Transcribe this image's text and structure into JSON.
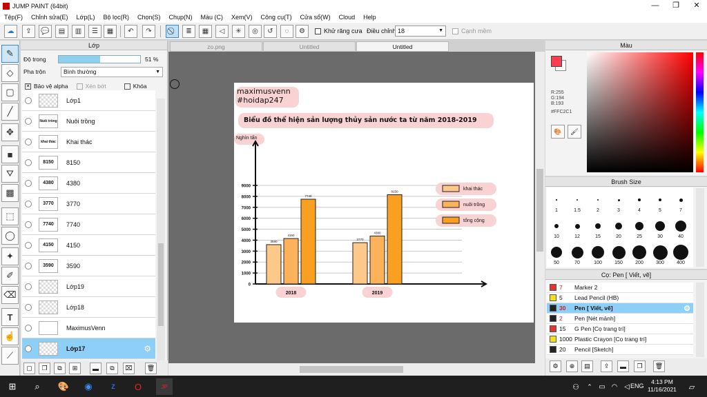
{
  "window": {
    "title": "JUMP PAINT (64bit)",
    "min": "—",
    "max": "❐",
    "close": "✕"
  },
  "menu": [
    "Tệp(F)",
    "Chỉnh sửa(E)",
    "Lớp(L)",
    "Bộ lọc(R)",
    "Chọn(S)",
    "Chụp(N)",
    "Màu (C)",
    "Xem(V)",
    "Công cụ(T)",
    "Cửa sổ(W)",
    "Cloud",
    "Help"
  ],
  "toolbar": {
    "antialias_label": "Khử răng cưa",
    "adjust_label": "Điều chỉnh",
    "adjust_value": "18",
    "smooth_label": "Cạnh mềm"
  },
  "layer_panel": {
    "title": "Lớp",
    "opacity_label": "Độ trong",
    "opacity_value": "51 %",
    "opacity_fraction": 0.51,
    "blend_label": "Pha trộn",
    "blend_value": "Bình thường",
    "protect_alpha": "Bảo vệ alpha",
    "clip": "Xén bớt",
    "lock": "Khóa",
    "layers": [
      {
        "name": "Lớp1",
        "thumb": ""
      },
      {
        "name": "Nuôi trồng",
        "thumb": "Nuôi trồng"
      },
      {
        "name": "Khai thác",
        "thumb": "khai thác"
      },
      {
        "name": "8150",
        "thumb": "8150"
      },
      {
        "name": "4380",
        "thumb": "4380"
      },
      {
        "name": "3770",
        "thumb": "3770"
      },
      {
        "name": "7740",
        "thumb": "7740"
      },
      {
        "name": "4150",
        "thumb": "4150"
      },
      {
        "name": "3590",
        "thumb": "3590"
      },
      {
        "name": "Lớp19",
        "thumb": ""
      },
      {
        "name": "Lớp18",
        "thumb": ""
      },
      {
        "name": "MaximusVenn",
        "thumb": ""
      },
      {
        "name": "Lớp17",
        "thumb": ""
      }
    ]
  },
  "tabs": [
    "zo.png",
    "Untitled",
    "Untitled"
  ],
  "canvas": {
    "author": "maximusvenn",
    "hashtag": "#hoidap247",
    "heading": "Biểu đồ thể hiện sản lượng thủy sản nước ta từ năm 2018-2019",
    "unit": "Nghìn tấn"
  },
  "chart_data": {
    "type": "bar",
    "categories": [
      "2018",
      "2019"
    ],
    "series": [
      {
        "name": "khai thác",
        "values": [
          3590,
          3770
        ],
        "color": "#fdc98a"
      },
      {
        "name": "nuôi trồng",
        "values": [
          4150,
          4380
        ],
        "color": "#fbb25a"
      },
      {
        "name": "tổng cộng",
        "values": [
          7740,
          8150
        ],
        "color": "#f9a022"
      }
    ],
    "yticks": [
      0,
      1000,
      2000,
      3000,
      4000,
      5000,
      6000,
      7000,
      8000,
      9000
    ],
    "ylim": [
      0,
      9000
    ],
    "ylabel": "Nghìn tấn",
    "legend": "right",
    "data_labels": true
  },
  "color_panel": {
    "title": "Màu",
    "r": "R:255",
    "g": "G:194",
    "b": "B:193",
    "hex": "#FFC2C1",
    "fg": "#ff3c50"
  },
  "brush_panel": {
    "title": "Brush Size",
    "sizes": [
      "1",
      "1.5",
      "2",
      "3",
      "4",
      "5",
      "7",
      "10",
      "12",
      "15",
      "20",
      "25",
      "30",
      "40",
      "50",
      "70",
      "100",
      "150",
      "200",
      "300",
      "400"
    ]
  },
  "pen_panel": {
    "title": "Cọ: Pen [ Viết, vẽ]",
    "items": [
      {
        "size": "7",
        "name": "Marker 2",
        "color": "#e83232"
      },
      {
        "size": "5",
        "name": "Lead Pencil (HB)",
        "color": "#f0e020"
      },
      {
        "size": "30",
        "name": "Pen [ Viết, vẽ]",
        "color": "#222222"
      },
      {
        "size": "2",
        "name": "Pen [Nét mảnh]",
        "color": "#222222"
      },
      {
        "size": "15",
        "name": "G Pen [Cọ trang trí]",
        "color": "#e83232"
      },
      {
        "size": "1000",
        "name": "Plastic Crayon [Cọ trang trí]",
        "color": "#f0e020"
      },
      {
        "size": "20",
        "name": "Pencil [Sketch]",
        "color": "#222222"
      }
    ]
  },
  "taskbar": {
    "time": "4:13 PM",
    "date": "11/16/2021",
    "lang": "ENG"
  }
}
